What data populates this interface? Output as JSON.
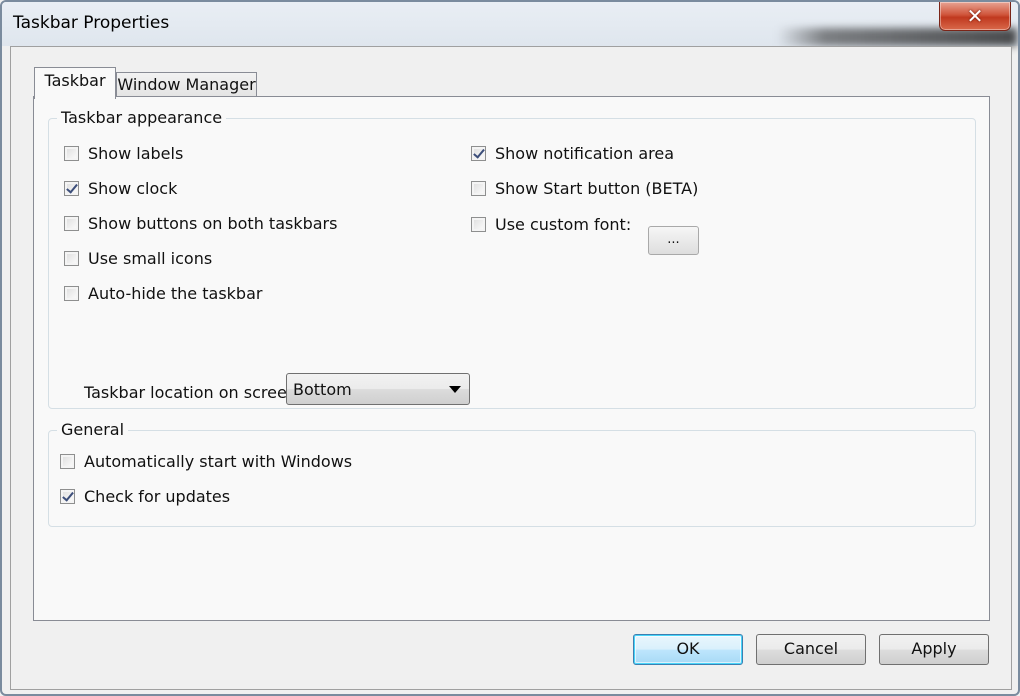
{
  "window": {
    "title": "Taskbar Properties",
    "close_glyph": "✕"
  },
  "tabs": [
    {
      "label": "Taskbar",
      "active": true
    },
    {
      "label": "Window Manager",
      "active": false
    }
  ],
  "appearance": {
    "group_label": "Taskbar appearance",
    "left_options": [
      {
        "label": "Show labels",
        "checked": false
      },
      {
        "label": "Show clock",
        "checked": true
      },
      {
        "label": "Show buttons on both taskbars",
        "checked": false
      },
      {
        "label": "Use small icons",
        "checked": false
      },
      {
        "label": "Auto-hide the taskbar",
        "checked": false
      }
    ],
    "right_options": [
      {
        "label": "Show notification area",
        "checked": true
      },
      {
        "label": "Show Start button (BETA)",
        "checked": false
      },
      {
        "label": "Use custom font:",
        "checked": false
      }
    ],
    "font_button_label": "...",
    "location_label": "Taskbar location on screen",
    "location_value": "Bottom"
  },
  "general": {
    "group_label": "General",
    "options": [
      {
        "label": "Automatically start with Windows",
        "checked": false
      },
      {
        "label": "Check for updates",
        "checked": true
      }
    ]
  },
  "buttons": {
    "ok": "OK",
    "cancel": "Cancel",
    "apply": "Apply"
  },
  "colors": {
    "close_button": "#c0391f",
    "default_button_border": "#3c7fb1",
    "check_mark": "#3c4e7a"
  }
}
